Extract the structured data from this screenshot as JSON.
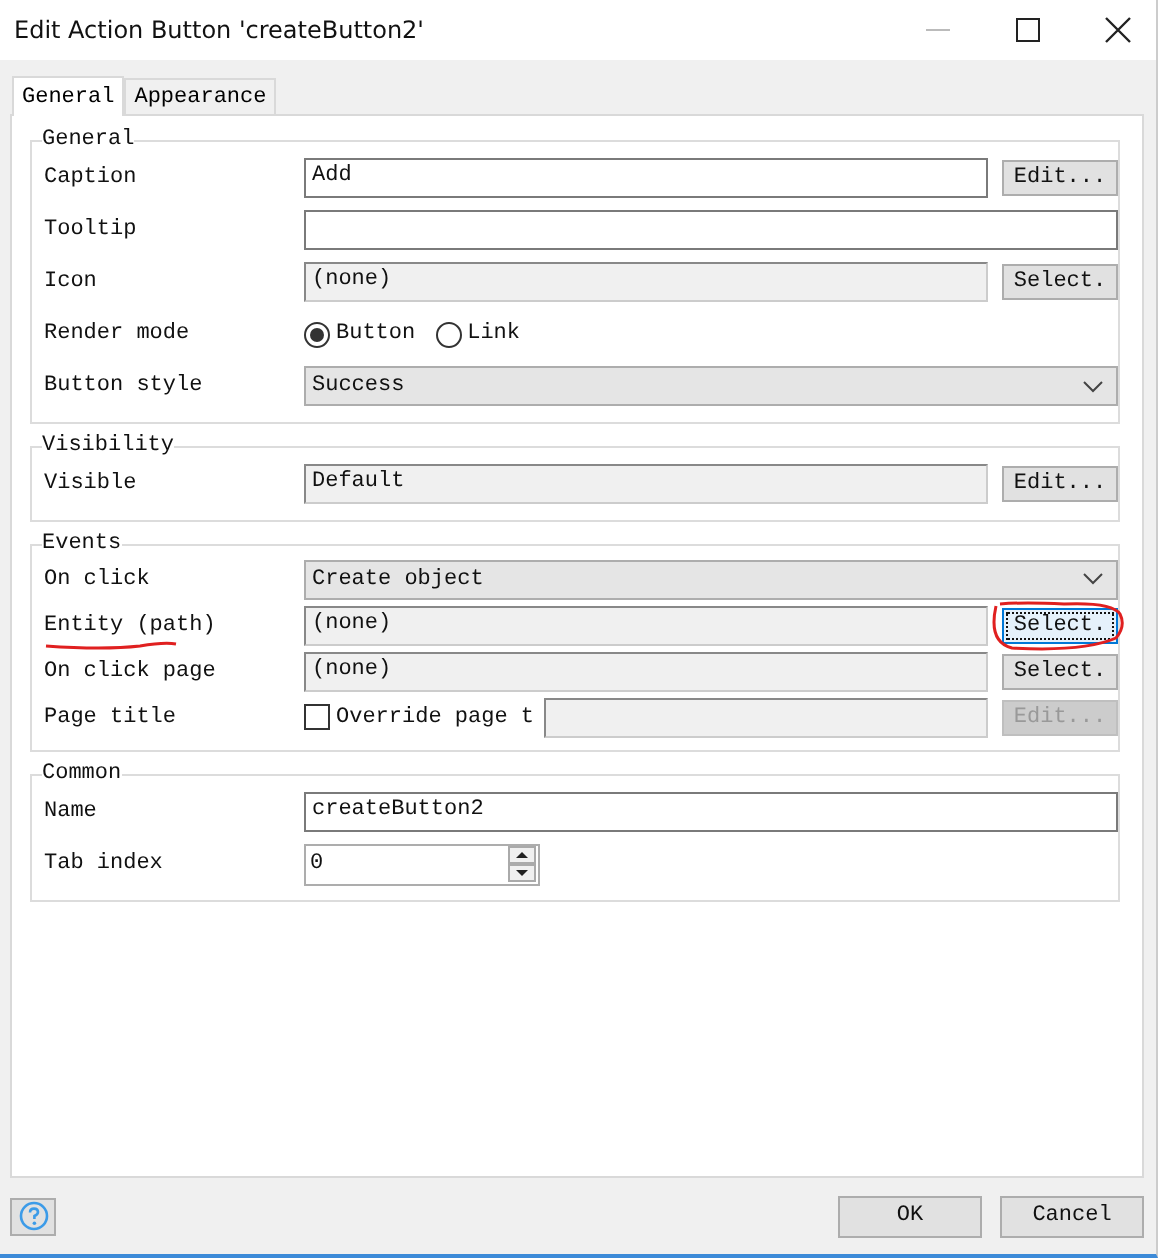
{
  "window": {
    "title": "Edit Action Button 'createButton2'"
  },
  "tabs": [
    {
      "label": "General",
      "selected": true
    },
    {
      "label": "Appearance",
      "selected": false
    }
  ],
  "groups": [
    {
      "title": "General",
      "rows": [
        {
          "kind": "text",
          "label": "Caption",
          "value": "Add",
          "button": {
            "label": "Edit...",
            "disabled": false,
            "focused": false
          }
        },
        {
          "kind": "text",
          "label": "Tooltip"
        },
        {
          "kind": "readonly",
          "label": "Icon",
          "value": "(none)",
          "button": {
            "label": "Select.",
            "disabled": false,
            "focused": false
          }
        },
        {
          "kind": "radio",
          "label": "Render mode",
          "options": [
            {
              "label": "Button",
              "selected": true
            },
            {
              "label": "Link",
              "selected": false
            }
          ]
        },
        {
          "kind": "select",
          "label": "Button style",
          "value": "Success"
        }
      ]
    },
    {
      "title": "Visibility",
      "rows": [
        {
          "kind": "readonly",
          "label": "Visible",
          "value": "Default",
          "button": {
            "label": "Edit...",
            "disabled": false,
            "focused": false
          }
        }
      ]
    },
    {
      "title": "Events",
      "rows": [
        {
          "kind": "select",
          "label": "On click",
          "value": "Create object"
        },
        {
          "kind": "readonly",
          "label": "Entity (path)",
          "value": "(none)",
          "annotated": true,
          "button": {
            "label": "Select.",
            "disabled": false,
            "focused": true
          }
        },
        {
          "kind": "readonly",
          "label": "On click page",
          "value": "(none)",
          "button": {
            "label": "Select.",
            "disabled": false,
            "focused": false
          }
        },
        {
          "kind": "checkbox",
          "label": "Page title",
          "option": "Override page t",
          "checked": false,
          "button": {
            "label": "Edit...",
            "disabled": true,
            "focused": false
          }
        }
      ]
    },
    {
      "title": "Common",
      "rows": [
        {
          "kind": "text",
          "label": "Name",
          "value": "createButton2"
        },
        {
          "kind": "spinner",
          "label": "Tab index",
          "value": "0"
        }
      ]
    }
  ],
  "footer": {
    "buttons": [
      "OK",
      "Cancel"
    ]
  }
}
